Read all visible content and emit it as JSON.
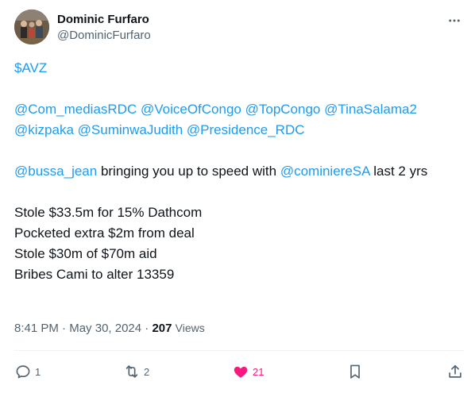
{
  "author": {
    "display_name": "Dominic Furfaro",
    "handle": "@DominicFurfaro"
  },
  "tweet": {
    "cashtag": "$AVZ",
    "mentions_line1": [
      "@Com_mediasRDC",
      "@VoiceOfCongo",
      "@TopCongo",
      "@TinaSalama2"
    ],
    "mentions_line2": [
      "@kizpaka",
      "@SuminwaJudith",
      "@Presidence_RDC"
    ],
    "sentence": {
      "mention_a": "@bussa_jean",
      "text_mid": " bringing you up to speed with ",
      "mention_b": "@cominiereSA",
      "text_end": " last 2 yrs"
    },
    "points": [
      "Stole $33.5m for 15% Dathcom",
      "Pocketed extra $2m from deal",
      "Stole $30m of $70m aid",
      "Bribes Cami to alter 13359"
    ]
  },
  "meta": {
    "time": "8:41 PM",
    "separator": "·",
    "date": "May 30, 2024",
    "views_count": "207",
    "views_label": "Views"
  },
  "actions": {
    "replies": "1",
    "reposts": "2",
    "likes": "21"
  },
  "colors": {
    "link": "#1d9bf0",
    "like": "#f91880",
    "muted": "#536471"
  }
}
